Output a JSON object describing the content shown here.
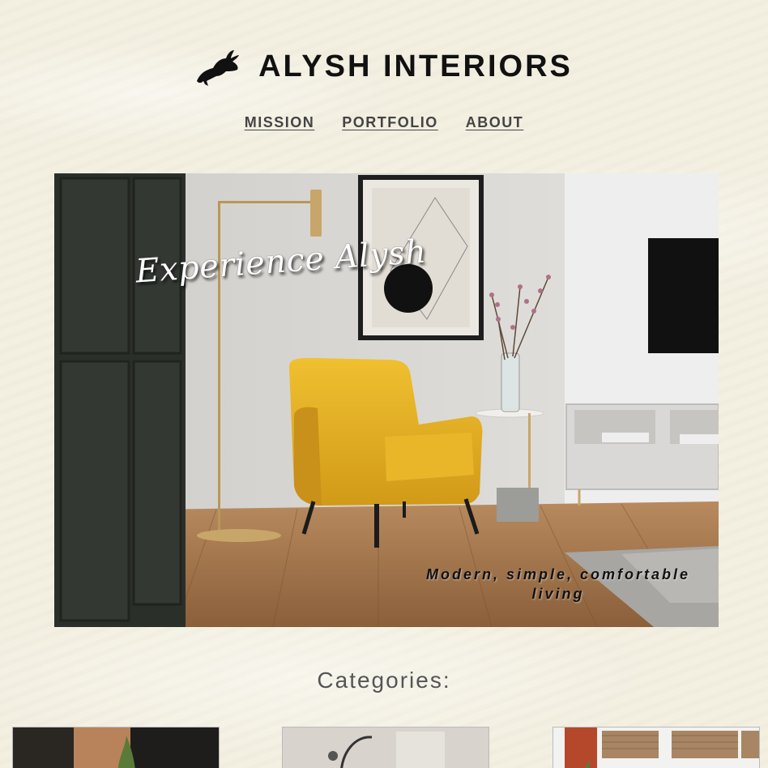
{
  "brand": {
    "name": "ALYSH INTERIORS",
    "logo_icon": "rabbit-icon"
  },
  "nav": {
    "items": [
      {
        "label": "MISSION"
      },
      {
        "label": "PORTFOLIO"
      },
      {
        "label": "ABOUT"
      }
    ]
  },
  "hero": {
    "title": "Experience Alysh",
    "tagline": "Modern, simple, comfortable living"
  },
  "categories": {
    "heading": "Categories:"
  },
  "colors": {
    "background": "#f3efe1",
    "accent_chair": "#e6b325",
    "text_dark": "#111111",
    "nav_text": "#444444"
  }
}
